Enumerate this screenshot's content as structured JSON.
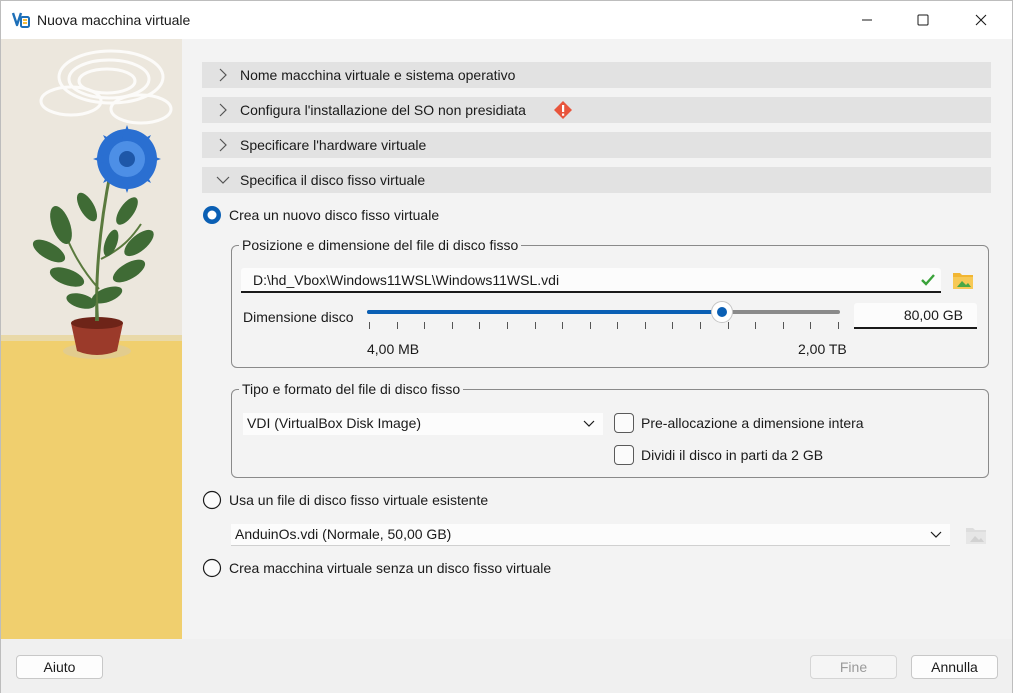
{
  "window": {
    "title": "Nuova macchina virtuale"
  },
  "sections": [
    {
      "label": "Nome macchina virtuale e sistema operativo",
      "expanded": false
    },
    {
      "label": "Configura l'installazione del SO non presidiata",
      "expanded": false,
      "warning": true
    },
    {
      "label": "Specificare l'hardware virtuale",
      "expanded": false
    },
    {
      "label": "Specifica il disco fisso virtuale",
      "expanded": true
    }
  ],
  "disk": {
    "option_new_label": "Crea un nuovo disco fisso virtuale",
    "option_new_selected": true,
    "location_group_title": "Posizione e dimensione del file di disco fisso",
    "path_value": "D:\\hd_Vbox\\Windows11WSL\\Windows11WSL.vdi",
    "size_label": "Dimensione disco",
    "size_value": "80,00 GB",
    "size_min_label": "4,00 MB",
    "size_max_label": "2,00 TB",
    "slider_fraction": 0.751,
    "type_group_title": "Tipo e formato del file di disco fisso",
    "format_selected": "VDI (VirtualBox Disk Image)",
    "prealloc_label": "Pre-allocazione a dimensione intera",
    "prealloc_checked": false,
    "split_label": "Dividi il disco in parti da 2 GB",
    "split_checked": false,
    "option_existing_label": "Usa un file di disco fisso virtuale esistente",
    "existing_selected": "AnduinOs.vdi (Normale, 50,00 GB)",
    "option_none_label": "Crea macchina virtuale senza un disco fisso virtuale"
  },
  "buttons": {
    "help": "Aiuto",
    "finish": "Fine",
    "cancel": "Annulla"
  },
  "colors": {
    "accent": "#0a5fb4",
    "section_bg": "#e2e2e2",
    "warning": "#e8553c"
  }
}
